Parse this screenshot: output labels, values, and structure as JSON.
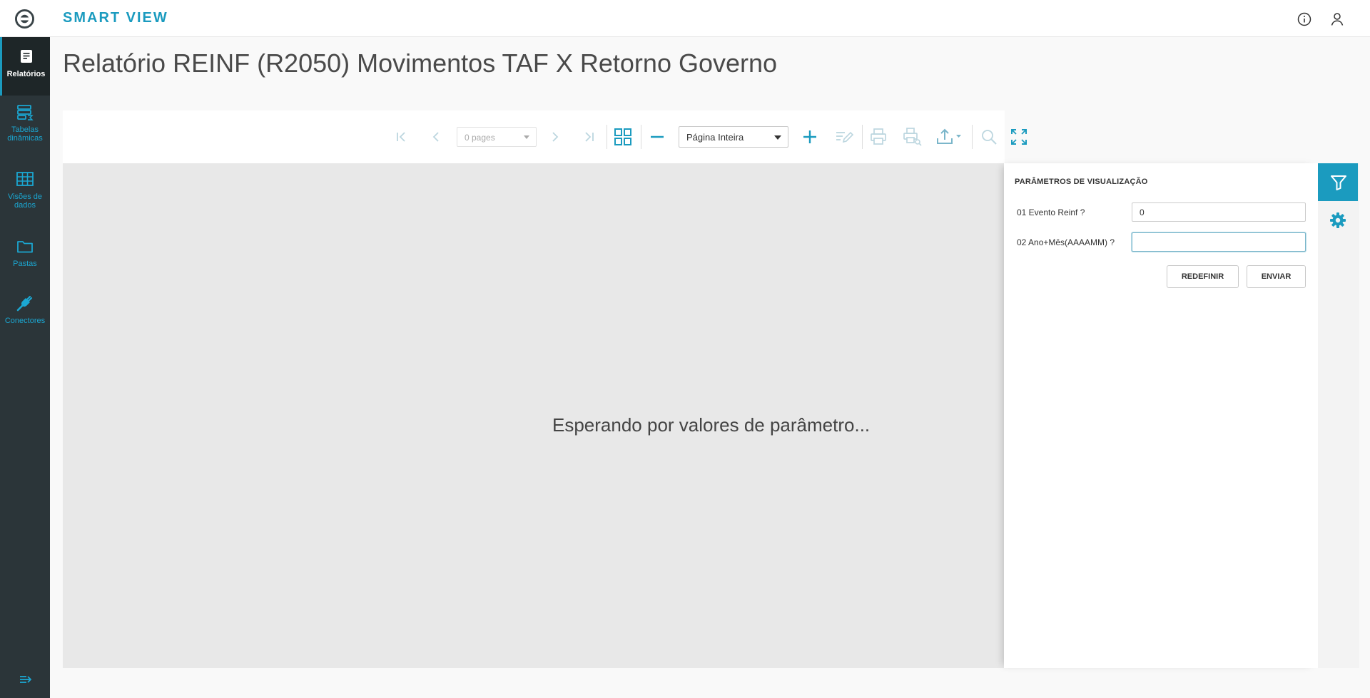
{
  "app": {
    "brand": "SMART VIEW"
  },
  "page": {
    "title": "Relatório REINF (R2050) Movimentos TAF X Retorno Governo"
  },
  "sidebar": {
    "items": [
      {
        "label": "Relatórios",
        "icon": "report-icon",
        "active": true
      },
      {
        "label": "Tabelas dinâmicas",
        "icon": "pivot-table-icon",
        "active": false
      },
      {
        "label": "Visões de dados",
        "icon": "grid-table-icon",
        "active": false
      },
      {
        "label": "Pastas",
        "icon": "folder-icon",
        "active": false
      },
      {
        "label": "Conectores",
        "icon": "plug-icon",
        "active": false
      }
    ]
  },
  "toolbar": {
    "pages_value": "0 pages",
    "zoom_value": "Página Inteira"
  },
  "viewer": {
    "message": "Esperando por valores de parâmetro..."
  },
  "params": {
    "title": "PARÂMETROS DE VISUALIZAÇÃO",
    "fields": [
      {
        "label": "01 Evento Reinf ?",
        "value": "0"
      },
      {
        "label": "02 Ano+Mês(AAAAMM) ?",
        "value": ""
      }
    ],
    "reset_label": "REDEFINIR",
    "submit_label": "ENVIAR"
  },
  "colors": {
    "accent": "#1b9bbf",
    "sidebar": "#2b3539"
  }
}
